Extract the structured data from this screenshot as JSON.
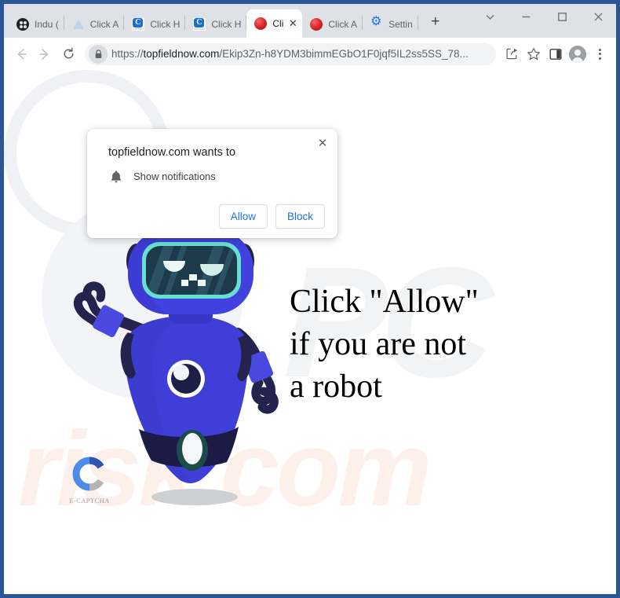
{
  "window": {
    "controls": [
      {
        "name": "tab-search",
        "icon": "chevron-down-icon",
        "label": "∨"
      },
      {
        "name": "minimize",
        "icon": "minimize-icon",
        "label": "─"
      },
      {
        "name": "maximize",
        "icon": "maximize-icon",
        "label": "□"
      },
      {
        "name": "close",
        "icon": "close-icon",
        "label": "✕"
      }
    ]
  },
  "tabs": [
    {
      "label": "Indu (",
      "favicon": "film-reel-icon",
      "active": false
    },
    {
      "label": "Click A",
      "favicon": "blue-triangle-icon",
      "active": false
    },
    {
      "label": "Click H",
      "favicon": "captcha-c-icon",
      "active": false
    },
    {
      "label": "Click H",
      "favicon": "captcha-c-icon",
      "active": false
    },
    {
      "label": "Cli",
      "favicon": "red-sphere-icon",
      "active": true
    },
    {
      "label": "Click A",
      "favicon": "red-sphere-icon",
      "active": false
    },
    {
      "label": "Settin",
      "favicon": "gear-icon",
      "active": false
    }
  ],
  "new_tab_label": "+",
  "toolbar": {
    "back_label": "←",
    "forward_label": "→",
    "reload_label": "↻",
    "url_scheme": "https://",
    "url_domain": "topfieldnow.com",
    "url_path": "/Ekip3Zn-h8YDM3bimmEGbO1F0jqf5IL2ss5SS_78...",
    "url_full": "https://topfieldnow.com/Ekip3Zn-h8YDM3bimmEGbO1F0jqf5IL2ss5SS_78...",
    "lock_icon": "lock-icon",
    "share_icon": "share-icon",
    "bookmark_icon": "star-icon",
    "sidepanel_icon": "side-panel-icon",
    "profile_icon": "avatar-icon",
    "menu_icon": "three-dot-menu-icon"
  },
  "permission_dialog": {
    "title": "topfieldnow.com wants to",
    "permission_icon": "bell-icon",
    "permission_text": "Show notifications",
    "allow_label": "Allow",
    "block_label": "Block",
    "close_label": "✕"
  },
  "page": {
    "headline": "Click \"Allow\"\nif you are not\na robot",
    "logo_text": "E-CAPTCHA",
    "watermark_pc": "PC",
    "watermark_risk": "risk.com",
    "robot_alt": "blue-robot-mascot"
  },
  "colors": {
    "accent_blue": "#1a73e8",
    "robot_body": "#3f3fd8",
    "robot_dark": "#1b1b45",
    "robot_visor": "#1d3a4a",
    "visor_border": "#66e0d2",
    "frame_blue": "#2a5596",
    "toolbar_bg": "#dee1e6",
    "watermark_peach": "#fdf0ea",
    "watermark_gray": "#f2f3f5"
  }
}
